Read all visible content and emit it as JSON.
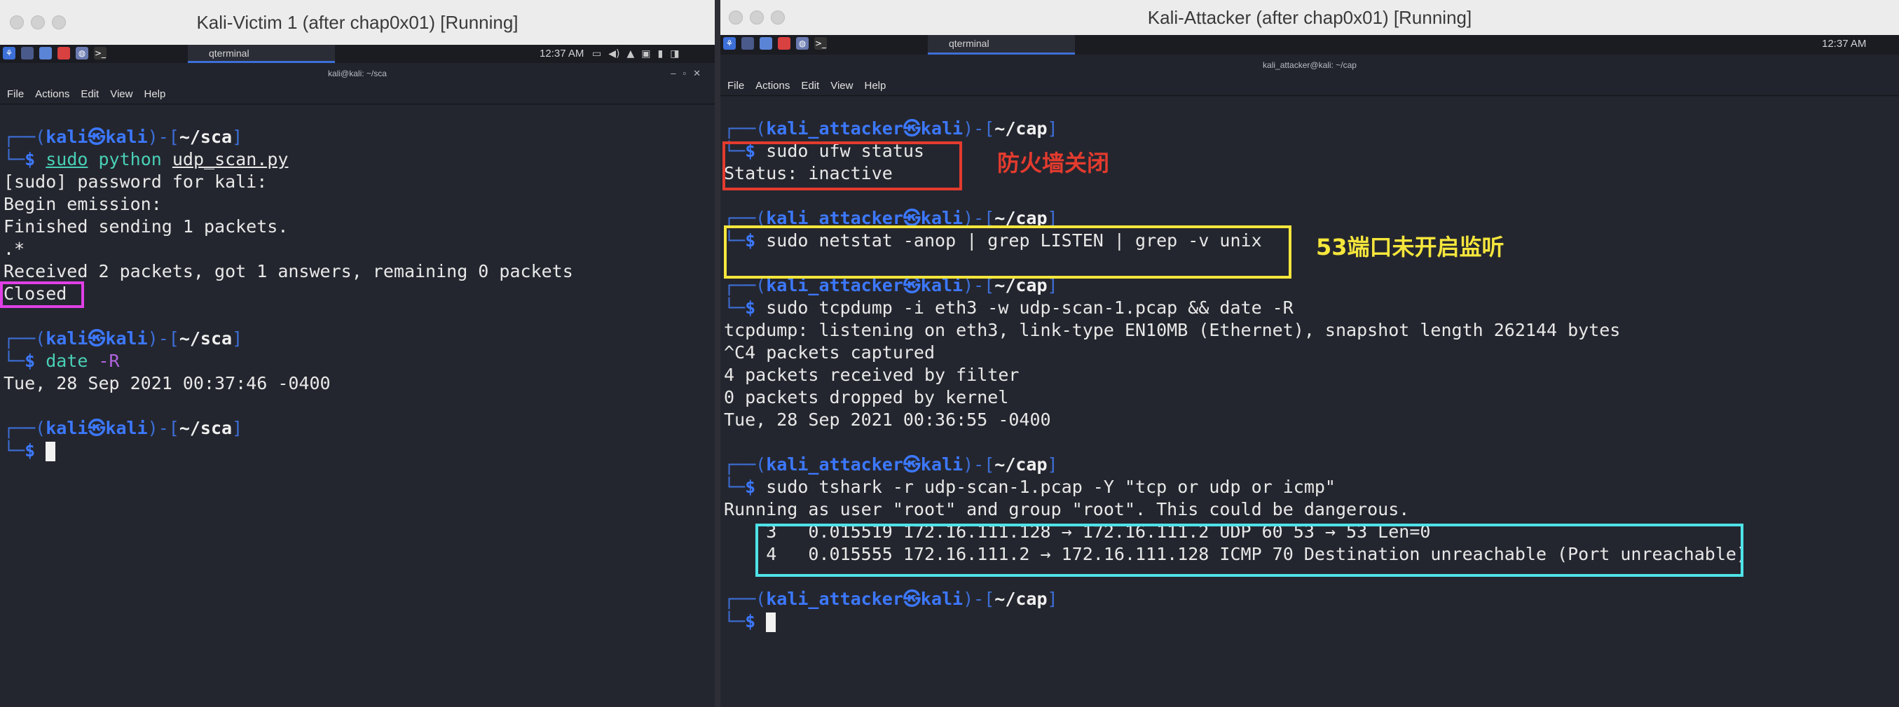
{
  "left": {
    "window_title": "Kali-Victim 1 (after chap0x01) [Running]",
    "taskbar": {
      "task_label": "qterminal",
      "clock": "12:37 AM"
    },
    "terminal": {
      "title": "kali@kali: ~/sca",
      "menu": [
        "File",
        "Actions",
        "Edit",
        "View",
        "Help"
      ],
      "user": "kali",
      "host": "kali",
      "cwd": "~/sca",
      "cmd1": {
        "word1": "sudo",
        "word2": "python",
        "word3": "udp_scan.py"
      },
      "output1": [
        "[sudo] password for kali:",
        "Begin emission:",
        "Finished sending 1 packets.",
        ".*",
        "Received 2 packets, got 1 answers, remaining 0 packets"
      ],
      "closed": "Closed",
      "cmd2": {
        "word1": "date",
        "word2": "-R"
      },
      "output2": "Tue, 28 Sep 2021 00:37:46 -0400"
    }
  },
  "right": {
    "window_title": "Kali-Attacker (after chap0x01) [Running]",
    "taskbar": {
      "task_label": "qterminal",
      "clock": "12:37 AM"
    },
    "terminal": {
      "title": "kali_attacker@kali: ~/cap",
      "menu": [
        "File",
        "Actions",
        "Edit",
        "View",
        "Help"
      ],
      "user": "kali_attacker",
      "host": "kali",
      "cwd": "~/cap",
      "cmd1": "sudo ufw status",
      "cmd1_output": "Status: inactive",
      "cmd2": "sudo netstat -anop | grep LISTEN | grep -v unix",
      "cmd3": "sudo tcpdump -i eth3 -w udp-scan-1.pcap && date -R",
      "cmd3_output": [
        "tcpdump: listening on eth3, link-type EN10MB (Ethernet), snapshot length 262144 bytes",
        "^C4 packets captured",
        "4 packets received by filter",
        "0 packets dropped by kernel",
        "Tue, 28 Sep 2021 00:36:55 -0400"
      ],
      "cmd4": "sudo tshark -r udp-scan-1.pcap -Y \"tcp or udp or icmp\"",
      "cmd4_output": [
        "Running as user \"root\" and group \"root\". This could be dangerous.",
        "    3   0.015519 172.16.111.128 → 172.16.111.2 UDP 60 53 → 53 Len=0",
        "    4   0.015555 172.16.111.2 → 172.16.111.128 ICMP 70 Destination unreachable (Port unreachable)"
      ]
    },
    "annotations": {
      "firewall_note": "防火墙关闭",
      "port_note": "53端口未开启监听"
    }
  },
  "colors": {
    "prompt_blue": "#3c78ff",
    "highlight_red": "#e33b2e",
    "highlight_yellow": "#f5e63c",
    "highlight_cyan": "#4fe3e8",
    "highlight_magenta": "#e040e6"
  }
}
